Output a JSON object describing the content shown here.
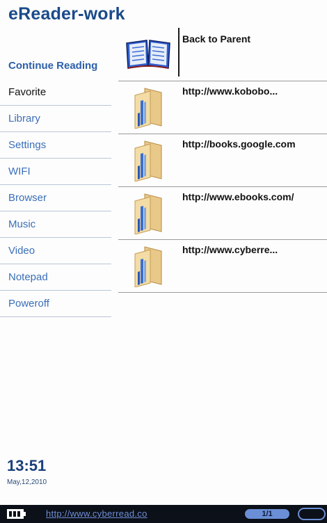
{
  "app": {
    "title": "eReader-work"
  },
  "sidebar": {
    "items": [
      {
        "label": "Continue Reading"
      },
      {
        "label": "Favorite"
      },
      {
        "label": "Library"
      },
      {
        "label": "Settings"
      },
      {
        "label": "WIFI"
      },
      {
        "label": "Browser"
      },
      {
        "label": "Music"
      },
      {
        "label": "Video"
      },
      {
        "label": "Notepad"
      },
      {
        "label": "Poweroff"
      }
    ],
    "selected": "Favorite"
  },
  "list": {
    "parent": {
      "label": "Back to Parent",
      "icon": "open-book-icon"
    },
    "items": [
      {
        "url": "http://www.kobobo...",
        "icon": "folder-icon"
      },
      {
        "url": "http://books.google.com",
        "icon": "folder-icon"
      },
      {
        "url": "http://www.ebooks.com/",
        "icon": "folder-icon"
      },
      {
        "url": "http://www.cyberre...",
        "icon": "folder-icon"
      }
    ]
  },
  "clock": {
    "time": "13:51",
    "date": "May,12,2010"
  },
  "status_bar": {
    "url": "http://www.cyberread.co",
    "page": "1/1",
    "battery_icon": "battery-icon"
  },
  "colors": {
    "title": "#1a4a8a",
    "sidebar_text": "#3a6fb8",
    "status_bar_bg": "#0c1018",
    "status_accent": "#6b8fd6"
  }
}
